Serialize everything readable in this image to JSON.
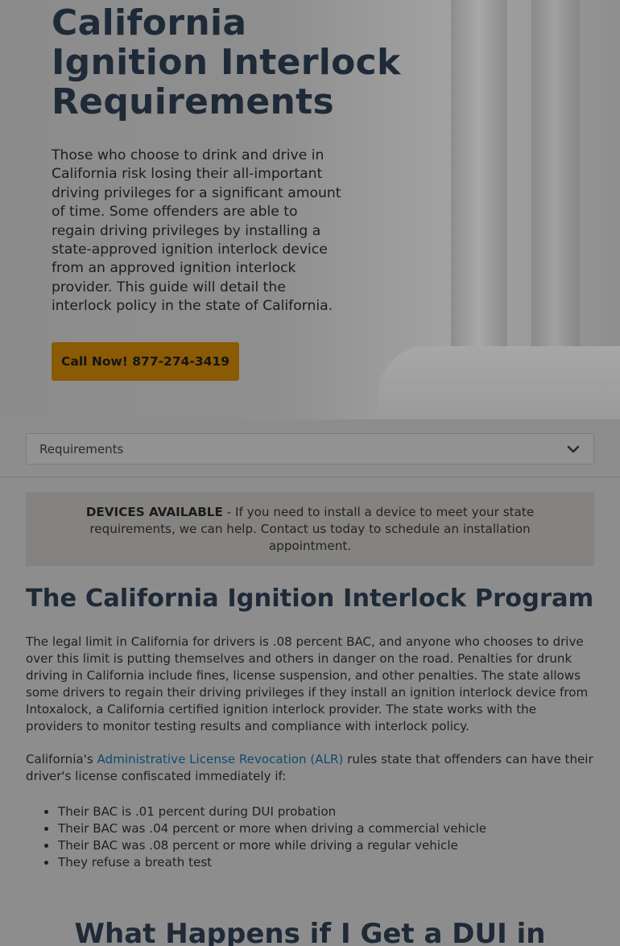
{
  "hero": {
    "title_lines": [
      "California",
      "Ignition Interlock",
      "Requirements"
    ],
    "description": "Those who choose to drink and drive in California risk losing their all-important driving privileges for a significant amount of time. Some offenders are able to regain driving privileges by installing a state-approved ignition interlock device from an approved ignition interlock provider. This guide will detail the interlock policy in the state of California.",
    "cta_label": "Call Now! 877-274-3419"
  },
  "section_select": {
    "selected": "Requirements",
    "icon": "chevron-down-icon"
  },
  "notice": {
    "bold": "DEVICES AVAILABLE",
    "text": " - If you need to install a device to meet your state requirements, we can help. Contact us today to schedule an installation appointment."
  },
  "main": {
    "heading": "The California Ignition Interlock Program",
    "para1": "The legal limit in California for drivers is .08 percent BAC, and anyone who chooses to drive over this limit is putting themselves and others in danger on the road. Penalties for drunk driving in California include fines, license suspension, and other penalties. The state allows some drivers to regain their driving privileges if they install an ignition interlock device from Intoxalock, a California certified ignition interlock provider. The state works with the providers to monitor testing results and compliance with interlock policy.",
    "para2_prefix": "California's ",
    "para2_link": "Administrative License Revocation (ALR)",
    "para2_suffix": " rules state that offenders can have their driver's license confiscated immediately if:",
    "list": [
      "Their BAC is .01 percent during DUI probation",
      "Their BAC was .04 percent or more when driving a commercial vehicle",
      "Their BAC was .08 percent or more while driving a regular vehicle",
      "They refuse a breath test"
    ],
    "heading2": "What Happens if I Get a DUI in"
  },
  "colors": {
    "heading": "#1e2a38",
    "cta": "#8a5a05",
    "link": "#0f4a6e"
  }
}
